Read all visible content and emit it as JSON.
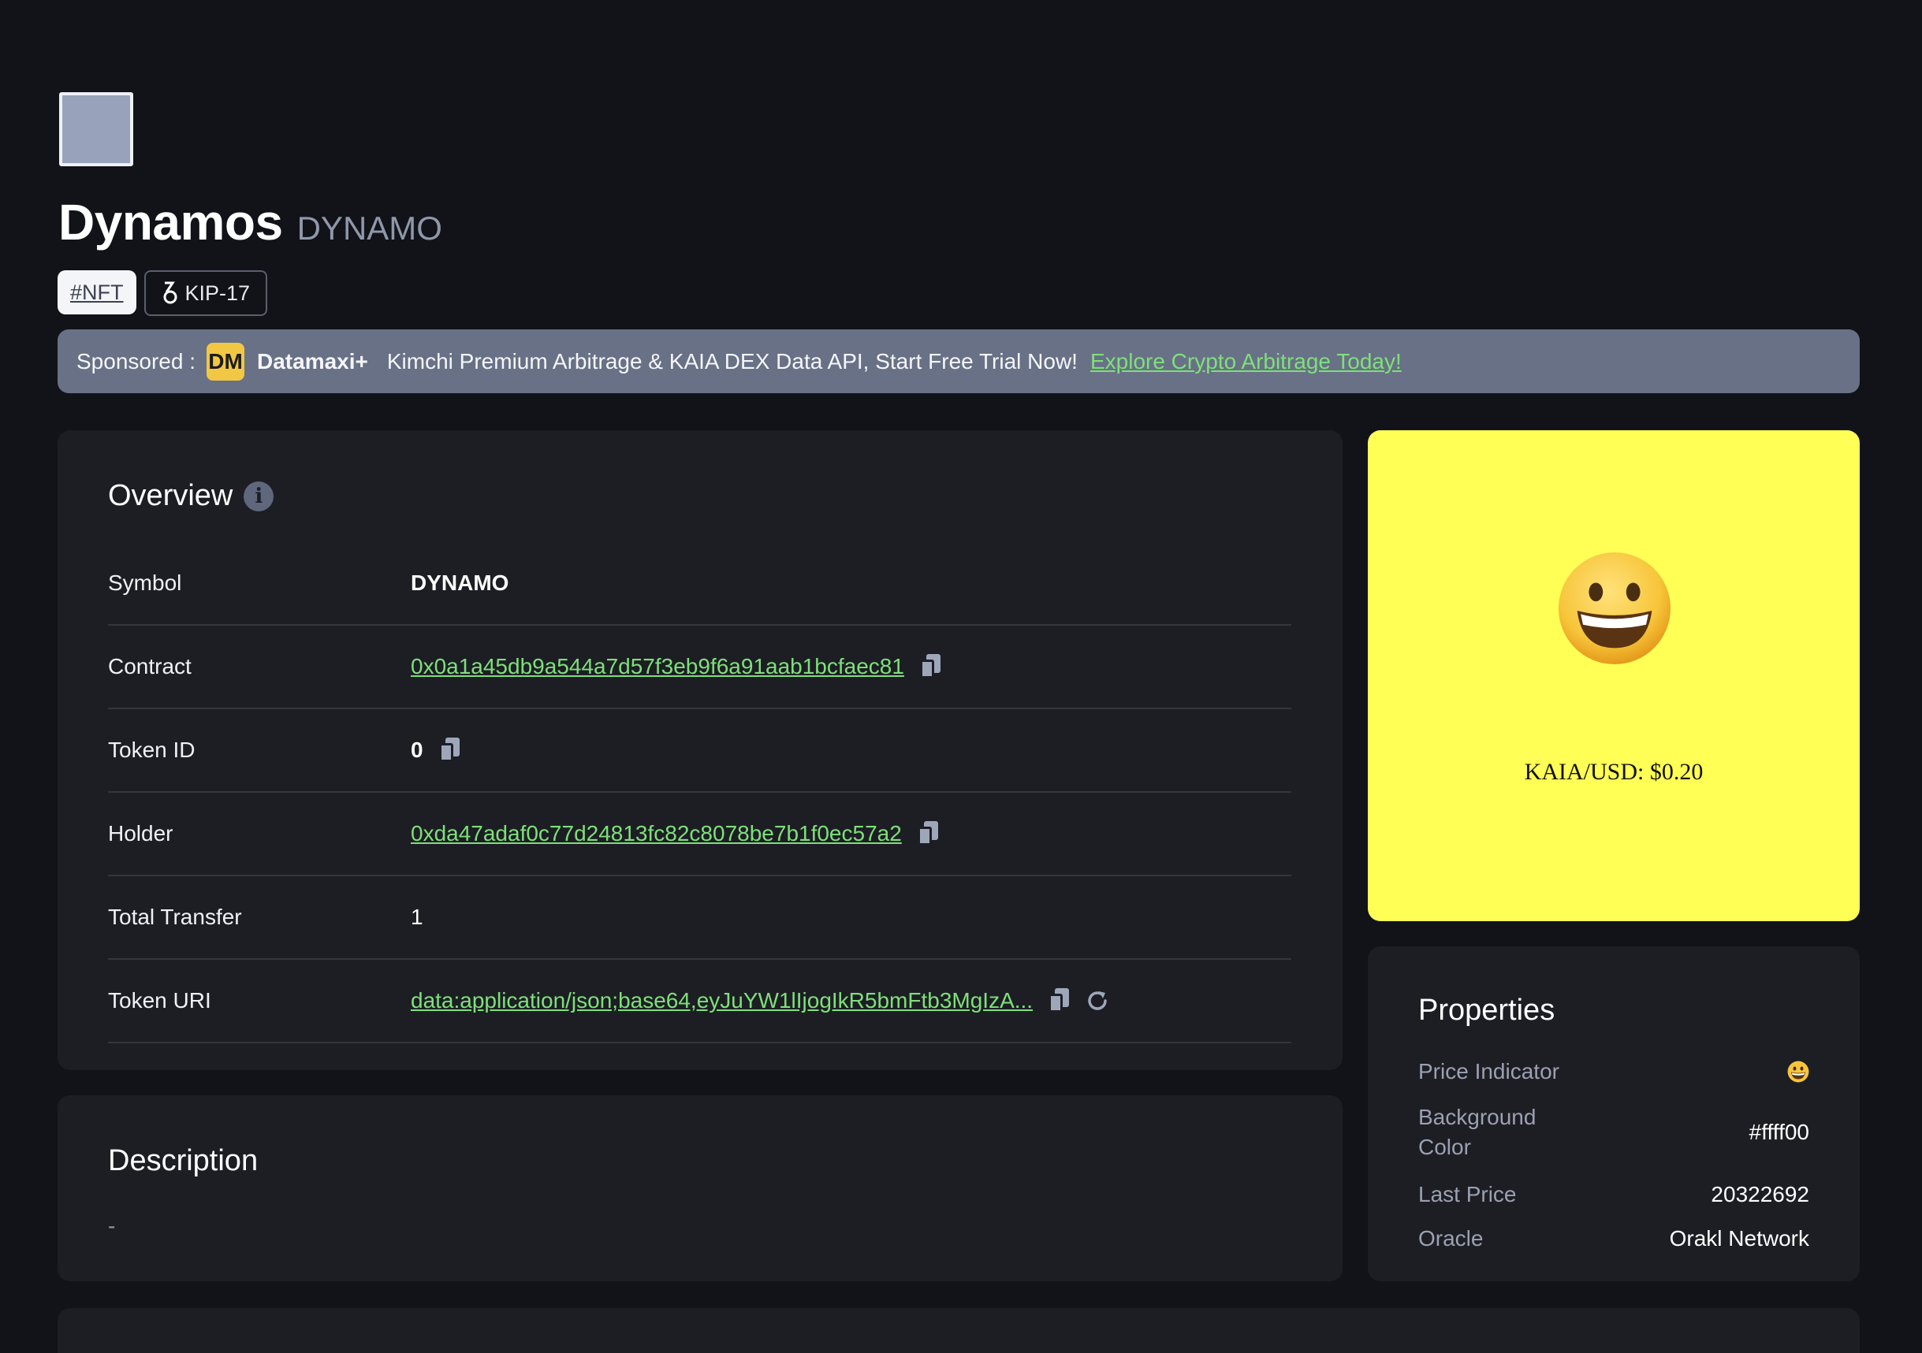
{
  "header": {
    "title": "Dynamos",
    "symbol": "DYNAMO",
    "tags": {
      "nft": "#NFT",
      "standard": "KIP-17"
    }
  },
  "banner": {
    "prefix": "Sponsored :",
    "logo_text": "DM",
    "brand": "Datamaxi+",
    "message": "Kimchi Premium Arbitrage & KAIA DEX Data API, Start Free Trial Now!",
    "cta": "Explore Crypto Arbitrage Today!"
  },
  "overview": {
    "title": "Overview",
    "info_icon": "i",
    "rows": [
      {
        "label": "Symbol",
        "value": "DYNAMO"
      },
      {
        "label": "Contract",
        "value": "0x0a1a45db9a544a7d57f3eb9f6a91aab1bcfaec81"
      },
      {
        "label": "Token ID",
        "value": "0"
      },
      {
        "label": "Holder",
        "value": "0xda47adaf0c77d24813fc82c8078be7b1f0ec57a2"
      },
      {
        "label": "Total Transfer",
        "value": "1"
      },
      {
        "label": "Token URI",
        "value": "data:application/json;base64,eyJuYW1lIjogIkR5bmFtb3MgIzA..."
      }
    ]
  },
  "description": {
    "title": "Description",
    "value": "-"
  },
  "preview": {
    "emoji": "grinning-face",
    "price_text": "KAIA/USD: $0.20",
    "background": "#ffff55"
  },
  "properties": {
    "title": "Properties",
    "rows": [
      {
        "label": "Price Indicator",
        "value": "grinning-face"
      },
      {
        "label": "Background Color",
        "value": "#ffff00"
      },
      {
        "label": "Last Price",
        "value": "20322692"
      },
      {
        "label": "Oracle",
        "value": "Orakl Network"
      }
    ]
  },
  "colors": {
    "background": "#111318",
    "card": "#1d1e24",
    "link": "#7ee07a",
    "banner": "#687186"
  }
}
